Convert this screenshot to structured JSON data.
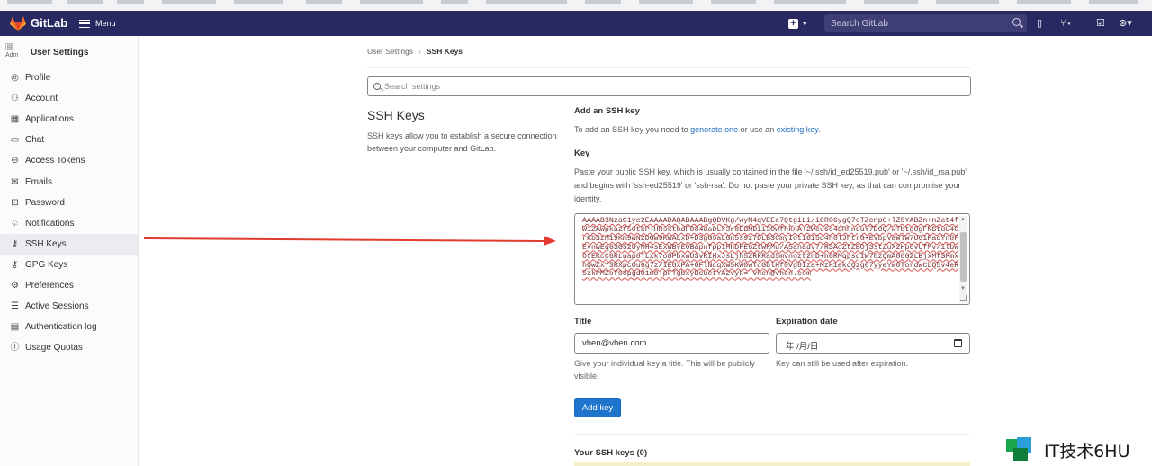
{
  "header": {
    "brand": "GitLab",
    "menu_label": "Menu",
    "search_placeholder": "Search GitLab"
  },
  "sidebar": {
    "avatar_alt": "Adm",
    "title": "User Settings",
    "items": [
      {
        "label": "Profile",
        "icon": "profile-icon"
      },
      {
        "label": "Account",
        "icon": "account-icon"
      },
      {
        "label": "Applications",
        "icon": "applications-icon"
      },
      {
        "label": "Chat",
        "icon": "chat-icon"
      },
      {
        "label": "Access Tokens",
        "icon": "token-icon"
      },
      {
        "label": "Emails",
        "icon": "mail-icon"
      },
      {
        "label": "Password",
        "icon": "lock-icon"
      },
      {
        "label": "Notifications",
        "icon": "bell-icon"
      },
      {
        "label": "SSH Keys",
        "icon": "key-icon",
        "active": true
      },
      {
        "label": "GPG Keys",
        "icon": "key-icon"
      },
      {
        "label": "Preferences",
        "icon": "preferences-icon"
      },
      {
        "label": "Active Sessions",
        "icon": "sessions-icon"
      },
      {
        "label": "Authentication log",
        "icon": "log-icon"
      },
      {
        "label": "Usage Quotas",
        "icon": "quota-icon"
      }
    ]
  },
  "breadcrumb": {
    "parent": "User Settings",
    "current": "SSH Keys"
  },
  "settings_search_placeholder": "Search settings",
  "section": {
    "title": "SSH Keys",
    "description": "SSH keys allow you to establish a secure connection between your computer and GitLab."
  },
  "form": {
    "add_title": "Add an SSH key",
    "add_sub_prefix": "To add an SSH key you need to",
    "add_sub_link1": "generate one",
    "add_sub_mid": "or use an",
    "add_sub_link2": "existing key",
    "add_sub_suffix": ".",
    "key_label": "Key",
    "key_help": "Paste your public SSH key, which is usually contained in the file '~/.ssh/id_ed25519.pub' or '~/.ssh/id_rsa.pub' and begins with 'ssh-ed25519' or 'ssh-rsa'. Do not paste your private SSH key, as that can compromise your identity.",
    "key_value": "AAAAB3NzaC1yc2EAAAADAQABAAABgQDVKg/wyM4qVEEe7QtgiLi/iCRO6ygQ7oTZcnpO+lZ5YABZn+nZat4fW1ZAWpkazf50tkP+HRsktbdF084daDLr3r8EBMDii3OwfhknA+2Weu6c4SRFnquY7D0Q/wTbtgOgFNStuU4GrKbSzM19Km9wN2DGW9KWALxD+D3gG5aLGn5s9z7DLB3CmyIoti6i5d4h0lJhtrG+EVbpVaWlW7UGiFadYn8FEvnwEq6SG52UyMH4sExWBvE0BapnfppIMhDFE6ZtWRMu/A5anadv7/RSAoZtZBOjSstZuX2Hp6vUfMv/ilbWOtEKcC6RLuap8TLxk7o8PbxwUSvRIHxJsLjh5ZRkRad5mvnozt2nD+hGRMqpsqIW78zQmA80G2LBjxMfSPmxhQwZxY3RXpcOu6g7z/IE8xPA+GFlNcqXW5KW0wTcGDlHf0Vg8Iza+MzH1ekdQzg67yyeYw0TordwCLQ5v4eR5zkPMZof08pgd01m0+pFTgbxyBeuctYA2vyk= vhen@vhen.com",
    "title_label": "Title",
    "title_value": "vhen@vhen.com",
    "title_help": "Give your individual key a title. This will be publicly visible.",
    "expiration_label": "Expiration date",
    "expiration_value": "年 /月/日",
    "expiration_help": "Key can still be used after expiration.",
    "add_button": "Add key"
  },
  "your_keys": "Your SSH keys (0)",
  "watermark": "IT技术6HU",
  "colors": {
    "topbar": "#292961",
    "primary": "#1f75cb",
    "arrow": "#e03b2e"
  }
}
